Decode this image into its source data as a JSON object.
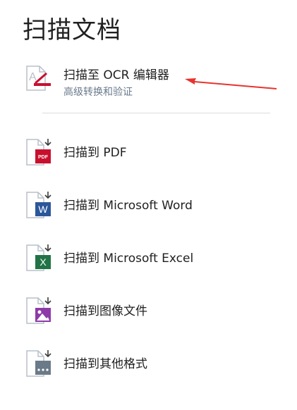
{
  "page": {
    "title": "扫描文档"
  },
  "ocr": {
    "label": "扫描至 OCR 编辑器",
    "sublabel": "高级转换和验证"
  },
  "items": [
    {
      "label": "扫描到 PDF",
      "badge": "PDF",
      "color": "#c8102e",
      "icon": "pdf-file-icon"
    },
    {
      "label": "扫描到 Microsoft Word",
      "badge": "W",
      "color": "#2b579a",
      "icon": "word-file-icon"
    },
    {
      "label": "扫描到 Microsoft Excel",
      "badge": "X",
      "color": "#217346",
      "icon": "excel-file-icon"
    },
    {
      "label": "扫描到图像文件",
      "badge": "",
      "color": "#8e3aa8",
      "icon": "image-file-icon"
    },
    {
      "label": "扫描到其他格式",
      "badge": "...",
      "color": "#6b7a88",
      "icon": "other-file-icon"
    }
  ],
  "annotation": {
    "arrow_color": "#e8332e"
  }
}
